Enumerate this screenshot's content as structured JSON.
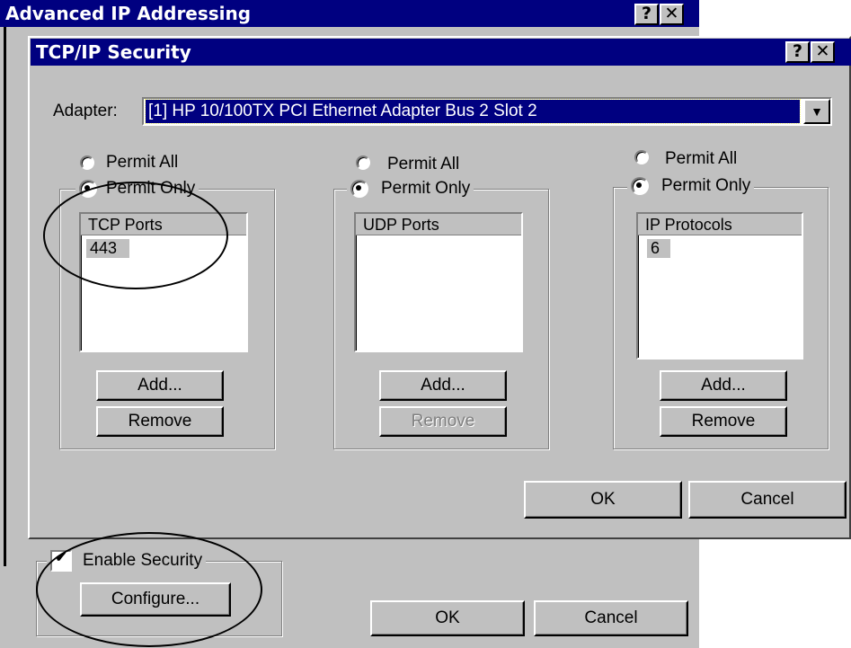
{
  "outer_dialog": {
    "title": "Advanced IP Addressing",
    "help_label": "?",
    "close_label": "✕",
    "enable_security_label": "Enable Security",
    "enable_security_checked": true,
    "checkmark": "✔",
    "configure_label": "Configure...",
    "ok_label": "OK",
    "cancel_label": "Cancel"
  },
  "security_dialog": {
    "title": "TCP/IP Security",
    "help_label": "?",
    "close_label": "✕",
    "adapter_label": "Adapter:",
    "adapter_value": "[1] HP 10/100TX PCI Ethernet Adapter Bus 2 Slot 2",
    "dropdown_arrow": "▼",
    "columns": [
      {
        "permit_all_label": "Permit All",
        "permit_only_label": "Permit Only",
        "selected": "permit_only",
        "list_header": "TCP Ports",
        "items": [
          "443"
        ],
        "add_label": "Add...",
        "remove_label": "Remove",
        "remove_enabled": true
      },
      {
        "permit_all_label": "Permit All",
        "permit_only_label": "Permit Only",
        "selected": "permit_only",
        "list_header": "UDP Ports",
        "items": [],
        "add_label": "Add...",
        "remove_label": "Remove",
        "remove_enabled": false
      },
      {
        "permit_all_label": "Permit All",
        "permit_only_label": "Permit Only",
        "selected": "permit_only",
        "list_header": "IP Protocols",
        "items": [
          "6"
        ],
        "add_label": "Add...",
        "remove_label": "Remove",
        "remove_enabled": true
      }
    ],
    "ok_label": "OK",
    "cancel_label": "Cancel"
  }
}
